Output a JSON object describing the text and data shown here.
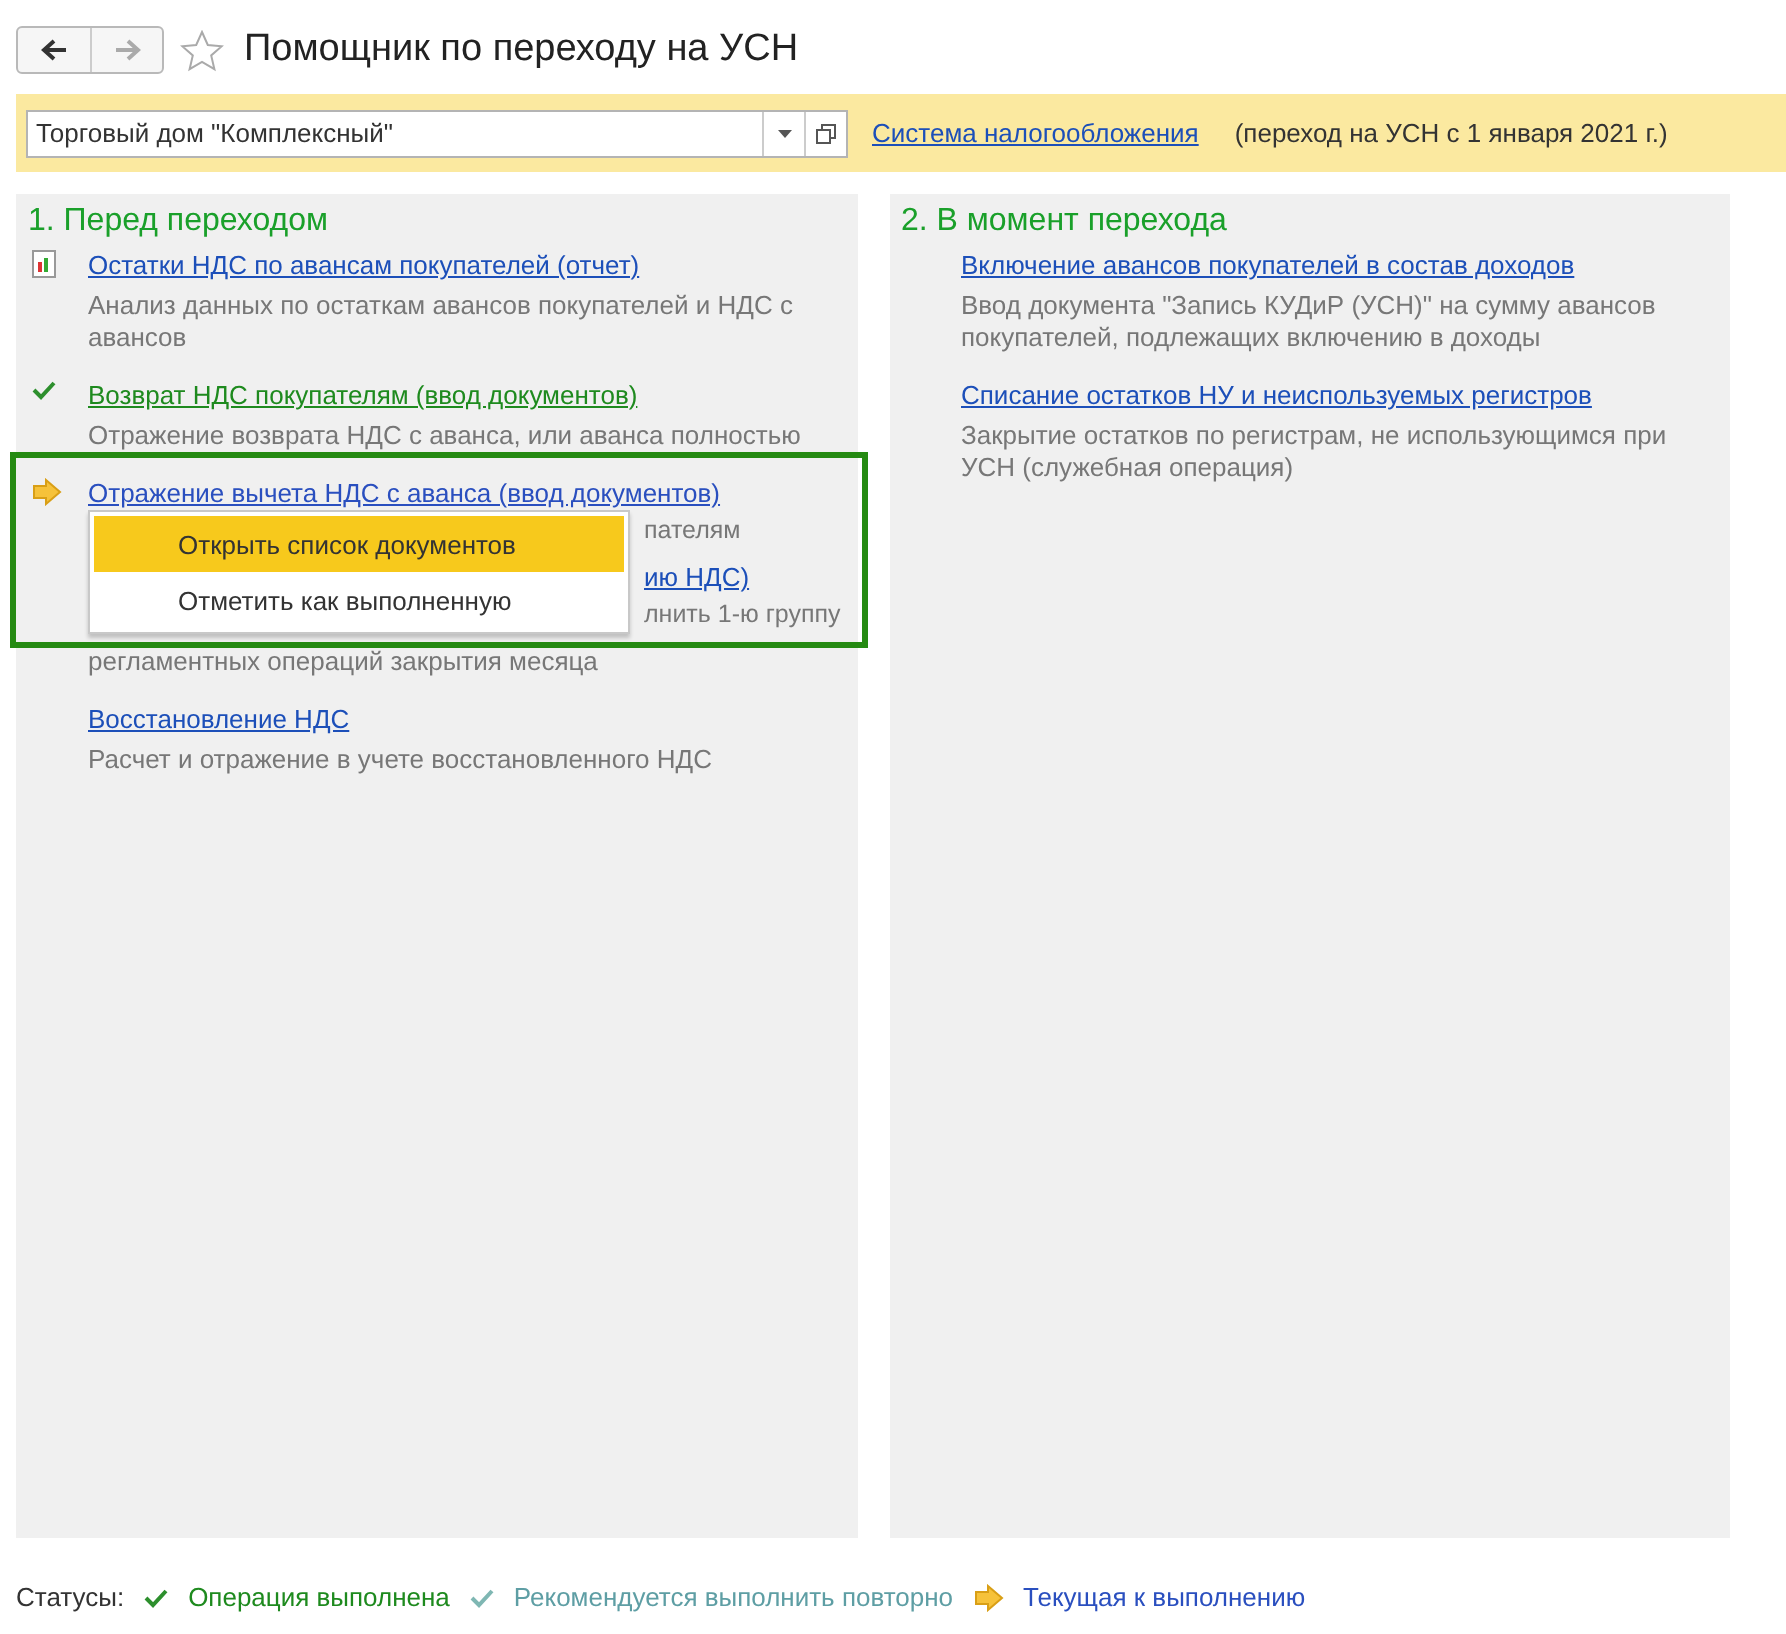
{
  "window": {
    "title": "Помощник по переходу на УСН"
  },
  "toolbar": {
    "organization": "Торговый дом \"Комплексный\"",
    "link": "Система налогообложения",
    "note": "(переход на УСН с 1 января 2021 г.)"
  },
  "sections": [
    {
      "title": "1. Перед переходом",
      "items": [
        {
          "kind": "report",
          "link": "Остатки НДС по авансам покупателей (отчет)",
          "description": "Анализ данных по остаткам авансов покупателей и НДС с авансов"
        },
        {
          "kind": "done",
          "link": "Возврат НДС покупателям (ввод документов)",
          "description": "Отражение возврата НДС с аванса, или аванса полностью"
        },
        {
          "kind": "current",
          "link": "Отражение вычета НДС с аванса (ввод документов)",
          "description_visible": "пателям",
          "menu": [
            {
              "label": "Открыть список документов",
              "selected": true
            },
            {
              "label": "Отметить как выполненную",
              "selected": false
            }
          ]
        },
        {
          "kind": "plain",
          "link_visible": "ию НДС)",
          "description_visible": "лнить 1-ю группу",
          "description_line2": "регламентных операций закрытия месяца"
        },
        {
          "kind": "plain",
          "link": "Восстановление НДС",
          "description": "Расчет и отражение в учете восстановленного НДС"
        }
      ]
    },
    {
      "title": "2. В момент перехода",
      "items": [
        {
          "kind": "plain",
          "link": "Включение авансов покупателей в состав доходов",
          "description": "Ввод документа \"Запись КУДиР (УСН)\" на сумму авансов покупателей, подлежащих включению в доходы"
        },
        {
          "kind": "plain",
          "link": "Списание остатков НУ и неиспользуемых регистров",
          "description": "Закрытие остатков по  регистрам, не использующимся при УСН (служебная операция)"
        }
      ]
    }
  ],
  "legend": {
    "label": "Статусы:",
    "items": [
      {
        "kind": "done",
        "label": "Операция выполнена"
      },
      {
        "kind": "repeat",
        "label": "Рекомендуется выполнить повторно"
      },
      {
        "kind": "current",
        "label": "Текущая к выполнению"
      }
    ]
  }
}
